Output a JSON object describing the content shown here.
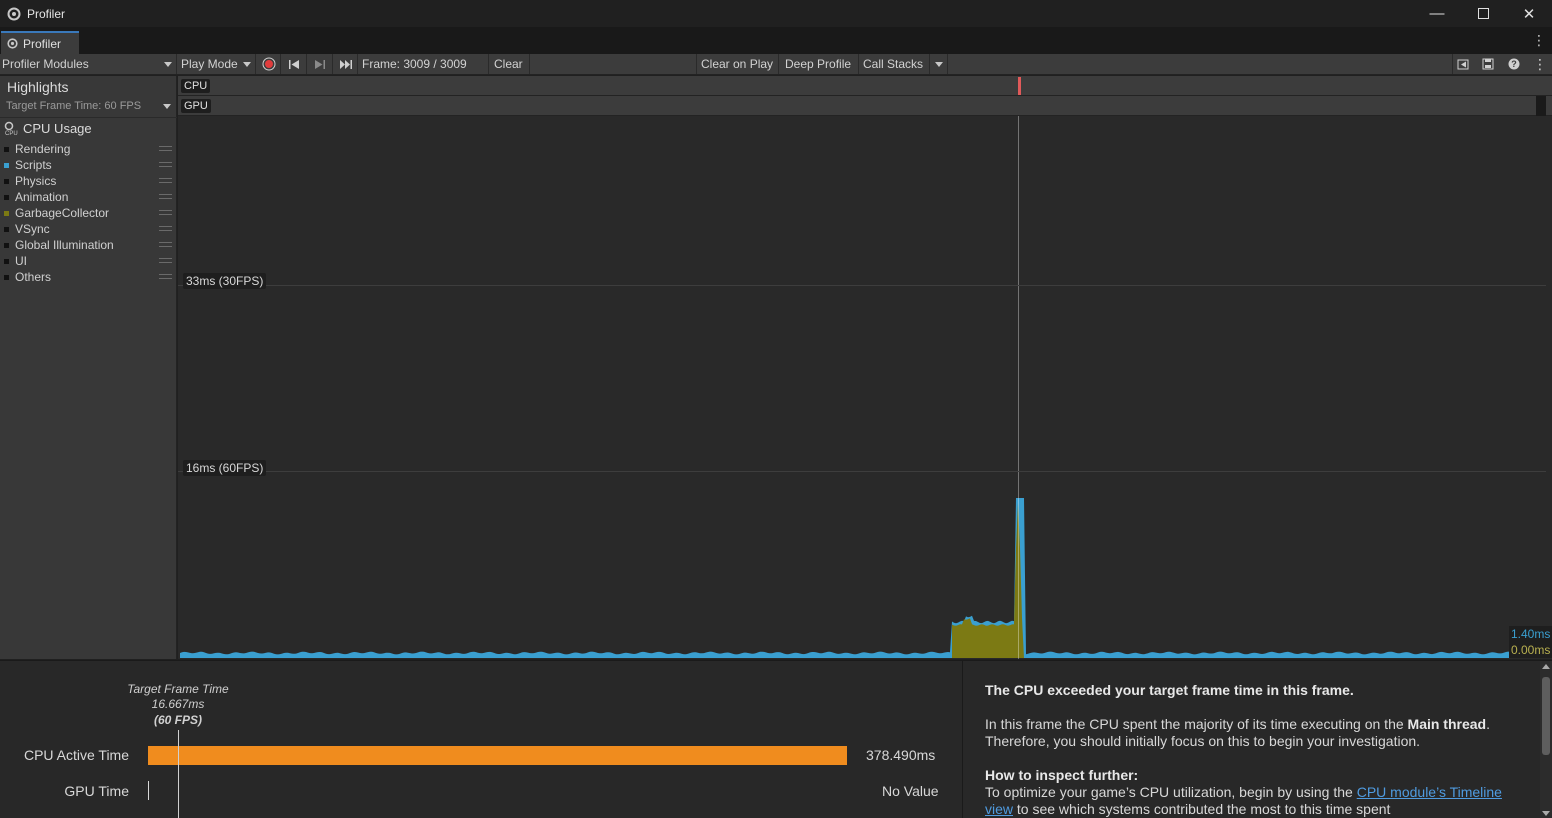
{
  "window": {
    "title": "Profiler",
    "tab_label": "Profiler"
  },
  "toolbar": {
    "modules_label": "Profiler Modules",
    "play_mode_label": "Play Mode",
    "frame_label": "Frame: 3009 / 3009",
    "clear_label": "Clear",
    "clear_on_play_label": "Clear on Play",
    "deep_profile_label": "Deep Profile",
    "call_stacks_label": "Call Stacks"
  },
  "highlights": {
    "title": "Highlights",
    "target_frame_time": "Target Frame Time: 60 FPS",
    "lanes": [
      "CPU",
      "GPU"
    ]
  },
  "cpu_module": {
    "title": "CPU Usage",
    "categories": [
      {
        "label": "Rendering",
        "color": "#111111"
      },
      {
        "label": "Scripts",
        "color": "#3a9fd0"
      },
      {
        "label": "Physics",
        "color": "#111111"
      },
      {
        "label": "Animation",
        "color": "#111111"
      },
      {
        "label": "GarbageCollector",
        "color": "#7c7a14"
      },
      {
        "label": "VSync",
        "color": "#111111"
      },
      {
        "label": "Global Illumination",
        "color": "#111111"
      },
      {
        "label": "UI",
        "color": "#111111"
      },
      {
        "label": "Others",
        "color": "#111111"
      }
    ]
  },
  "chart_data": {
    "type": "area",
    "title": "CPU Usage",
    "series": [
      {
        "name": "Scripts",
        "color": "#3a9fd0"
      },
      {
        "name": "GarbageCollector",
        "color": "#7c7a14"
      }
    ],
    "grid_labels": [
      "33ms (30FPS)",
      "16ms (60FPS)"
    ],
    "value_labels": [
      {
        "text": "1.40ms",
        "color": "#3a9fd0"
      },
      {
        "text": "0.00ms",
        "color": "#b8b050"
      }
    ],
    "ylim": [
      0,
      40
    ]
  },
  "frame_summary": {
    "target_label": "Target Frame Time",
    "target_ms": "16.667ms",
    "target_fps": "(60 FPS)",
    "cpu_label": "CPU Active Time",
    "cpu_value": "378.490ms",
    "gpu_label": "GPU Time",
    "gpu_value": "No Value"
  },
  "insight": {
    "heading": "The CPU exceeded your target frame time in this frame.",
    "para1_a": "In this frame the CPU spent the majority of its time executing on the ",
    "para1_b": "Main thread",
    "para1_c": ". Therefore, you should initially focus on this to begin your investigation.",
    "how_heading": "How to inspect further:",
    "para2_a": "To optimize your game’s CPU utilization, begin by using the ",
    "para2_link": "CPU module’s Timeline view",
    "para2_b": " to see which systems contributed the most to this time spent"
  }
}
